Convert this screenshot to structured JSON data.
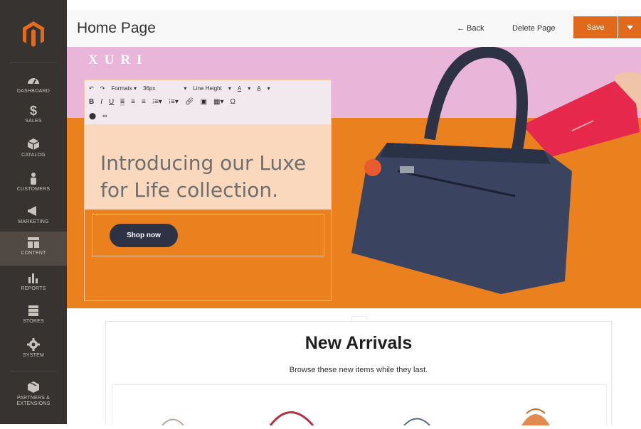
{
  "header": {
    "title": "Home Page",
    "back_label": "← Back",
    "delete_label": "Delete Page",
    "save_label": "Save"
  },
  "sidebar": {
    "items": [
      {
        "label": "DASHBOARD",
        "icon": "dashboard-icon"
      },
      {
        "label": "SALES",
        "icon": "dollar-icon"
      },
      {
        "label": "CATALOG",
        "icon": "cube-icon"
      },
      {
        "label": "CUSTOMERS",
        "icon": "person-icon"
      },
      {
        "label": "MARKETING",
        "icon": "megaphone-icon"
      },
      {
        "label": "CONTENT",
        "icon": "layout-icon",
        "active": true
      },
      {
        "label": "REPORTS",
        "icon": "bar-chart-icon"
      },
      {
        "label": "STORES",
        "icon": "store-icon"
      },
      {
        "label": "SYSTEM",
        "icon": "gear-icon"
      },
      {
        "label": "PARTNERS &",
        "label2": "EXTENSIONS",
        "icon": "box-icon"
      }
    ]
  },
  "hero": {
    "brand": "XURI",
    "headline_line1": "Introducing our Luxe",
    "headline_line2": "for Life collection.",
    "button": "Shop now",
    "toolbar": {
      "formats": "Formats ▾",
      "font_size": "36px",
      "line_height": "Line Height"
    }
  },
  "new_arrivals": {
    "title": "New Arrivals",
    "subtitle": "Browse these new items while they last."
  },
  "colors": {
    "sidebar": "#373330",
    "accent": "#e0691c",
    "hero_pink": "#e9b5d9",
    "hero_orange": "#ea811e",
    "button_dark": "#2d3245"
  }
}
